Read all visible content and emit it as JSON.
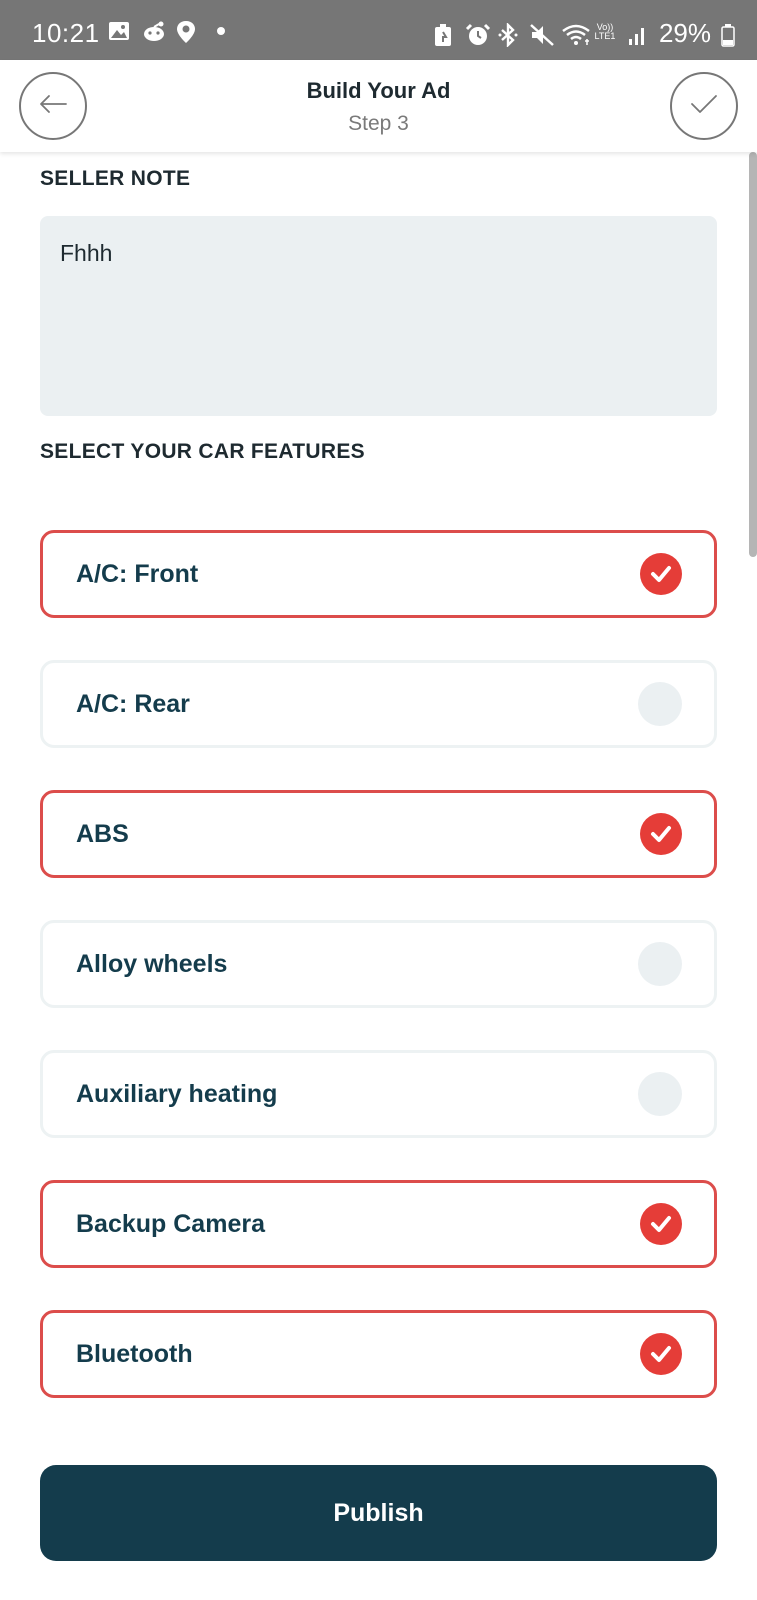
{
  "status_bar": {
    "time": "10:21",
    "battery": "29%",
    "lte_top": "Vo))",
    "lte_bottom": "LTE1",
    "left_icons": [
      "gallery-icon",
      "reddit-icon",
      "location-icon",
      "dot-icon"
    ],
    "right_icons": [
      "battery-saver-icon",
      "alarm-icon",
      "bluetooth-icon",
      "mute-icon",
      "wifi-icon",
      "volte-icon",
      "signal-icon",
      "battery-icon"
    ]
  },
  "header": {
    "title": "Build Your Ad",
    "subtitle": "Step 3",
    "back_icon": "arrow-left-icon",
    "confirm_icon": "checkmark-icon"
  },
  "seller_note": {
    "label": "SELLER NOTE",
    "value": "Fhhh"
  },
  "features": {
    "label": "SELECT YOUR CAR FEATURES",
    "items": [
      {
        "label": "A/C: Front",
        "selected": true
      },
      {
        "label": "A/C: Rear",
        "selected": false
      },
      {
        "label": "ABS",
        "selected": true
      },
      {
        "label": "Alloy wheels",
        "selected": false
      },
      {
        "label": "Auxiliary heating",
        "selected": false
      },
      {
        "label": "Backup Camera",
        "selected": true
      },
      {
        "label": "Bluetooth",
        "selected": true
      }
    ]
  },
  "publish": {
    "label": "Publish"
  },
  "colors": {
    "primary": "#143c4c",
    "accent_red": "#e53d38",
    "selected_border": "#dc4d4b",
    "note_bg": "#ebf0f2"
  }
}
